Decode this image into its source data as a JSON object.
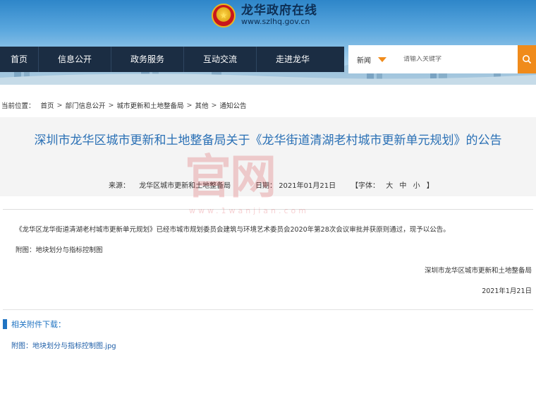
{
  "header": {
    "site_name": "龙华政府在线",
    "site_url": "www.szlhq.gov.cn"
  },
  "nav": {
    "items": [
      "首页",
      "信息公开",
      "政务服务",
      "互动交流",
      "走进龙华"
    ]
  },
  "search": {
    "category": "新闻",
    "placeholder": "请输入关键字"
  },
  "breadcrumb": {
    "label": "当前位置：",
    "items": [
      "首页",
      "部门信息公开",
      "城市更新和土地整备局",
      "其他",
      "通知公告"
    ]
  },
  "article": {
    "title": "深圳市龙华区城市更新和土地整备局关于《龙华街道清湖老村城市更新单元规划》的公告",
    "source_label": "来源：",
    "source": "龙华区城市更新和土地整备局",
    "date_label": "日期：",
    "date": "2021年01月21日",
    "font_label": "【字体：",
    "font_large": "大",
    "font_medium": "中",
    "font_small": "小",
    "font_close": "】",
    "body": "《龙华区龙华街道清湖老村城市更新单元规划》已经市城市规划委员会建筑与环境艺术委员会2020年第28次会议审批并获原则通过，现予以公告。",
    "attachment_note": "附图：地块划分与指标控制图",
    "signature": "深圳市龙华区城市更新和土地整备局",
    "sign_date": "2021年1月21日"
  },
  "attachments": {
    "heading": "相关附件下载：",
    "items": [
      "附图：地块划分与指标控制图.jpg"
    ]
  },
  "watermark": {
    "chars": "官网",
    "url": "www.1wanjian.com"
  },
  "colors": {
    "nav_bg": "#1b2d43",
    "accent_orange": "#f08b1b",
    "title_blue": "#2a70b5",
    "link_blue": "#1f5fa8"
  }
}
